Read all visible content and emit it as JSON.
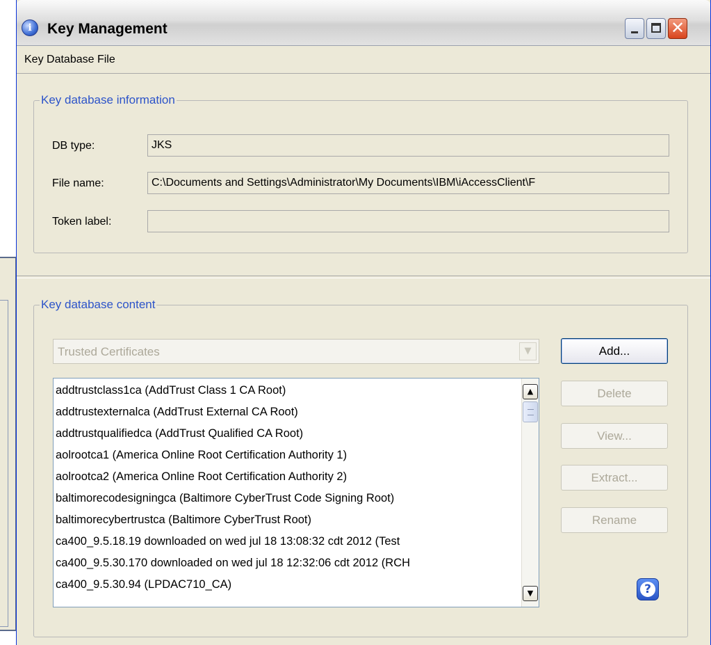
{
  "window": {
    "title": "Key Management",
    "close_glyph": "✕"
  },
  "menubar": {
    "items": [
      "Key Database File"
    ]
  },
  "info": {
    "legend": "Key database information",
    "db_type_label": "DB type:",
    "db_type_value": "JKS",
    "file_name_label": "File name:",
    "file_name_value": "C:\\Documents and Settings\\Administrator\\My Documents\\IBM\\iAccessClient\\F",
    "token_label_label": "Token label:",
    "token_label_value": ""
  },
  "content": {
    "legend": "Key database content",
    "selected_type": "Trusted Certificates",
    "items": [
      "addtrustclass1ca (AddTrust Class 1 CA Root)",
      "addtrustexternalca (AddTrust External CA Root)",
      "addtrustqualifiedca (AddTrust Qualified CA Root)",
      "aolrootca1 (America Online Root Certification Authority 1)",
      "aolrootca2 (America Online Root Certification Authority 2)",
      "baltimorecodesigningca (Baltimore CyberTrust Code Signing Root)",
      "baltimorecybertrustca (Baltimore CyberTrust Root)",
      "ca400_9.5.18.19 downloaded on wed jul 18 13:08:32 cdt 2012 (Test",
      "ca400_9.5.30.170 downloaded on wed jul 18 12:32:06 cdt 2012 (RCH",
      "ca400_9.5.30.94 (LPDAC710_CA)"
    ],
    "buttons": {
      "add": "Add...",
      "delete": "Delete",
      "view": "View...",
      "extract": "Extract...",
      "rename": "Rename"
    }
  },
  "icons": {
    "app": "info-icon",
    "help": "help-icon",
    "minimize": "minimize-icon",
    "maximize": "maximize-icon",
    "close": "close-icon"
  }
}
